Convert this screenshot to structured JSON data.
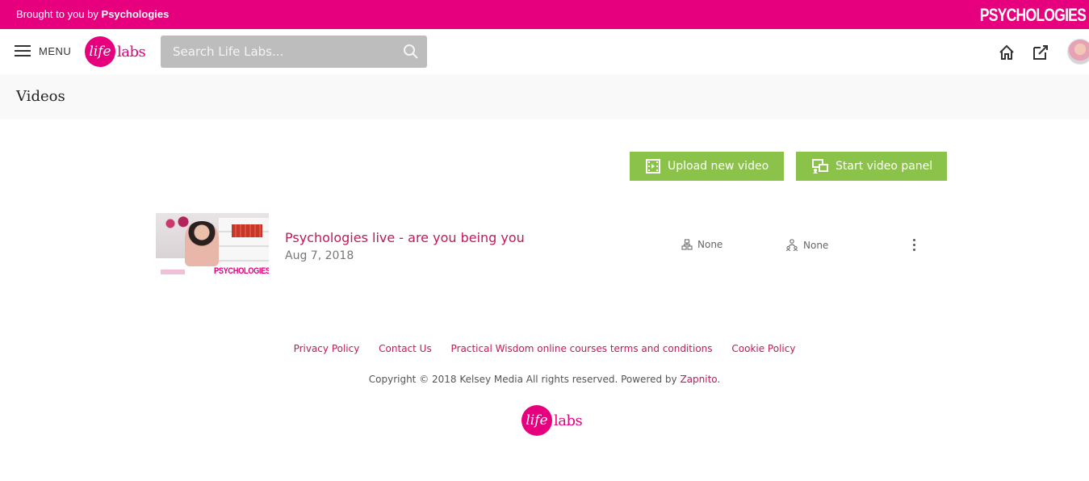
{
  "topbar": {
    "brought_prefix": "Brought to you by",
    "brought_brand": "Psychologies",
    "brand_logo": "PSYCHOLOGIES"
  },
  "navbar": {
    "menu_label": "MENU",
    "logo_life": "life",
    "logo_labs": "labs",
    "search_placeholder": "Search Life Labs...",
    "icons": [
      "menu-icon",
      "search-icon",
      "home-icon",
      "edit-icon",
      "avatar"
    ]
  },
  "page": {
    "title": "Videos"
  },
  "actions": {
    "upload_label": "Upload new video",
    "panel_label": "Start video panel"
  },
  "videos": [
    {
      "title": "Psychologies live - are you being you",
      "date": "Aug 7, 2018",
      "thumb_brand": "PSYCHOLOGIES",
      "meta1": "None",
      "meta2": "None"
    }
  ],
  "footer": {
    "links": [
      "Privacy Policy",
      "Contact Us",
      "Practical Wisdom online courses terms and conditions",
      "Cookie Policy"
    ],
    "copyright_prefix": "Copyright © 2018 Kelsey Media All rights reserved. Powered by",
    "copyright_link": "Zapnito",
    "copyright_suffix": ".",
    "logo_life": "life",
    "logo_labs": "labs"
  },
  "colors": {
    "brand_pink": "#e6007e",
    "link_pink": "#c2185b",
    "button_green": "#8bc34a",
    "search_bg": "#bdbdbd"
  }
}
